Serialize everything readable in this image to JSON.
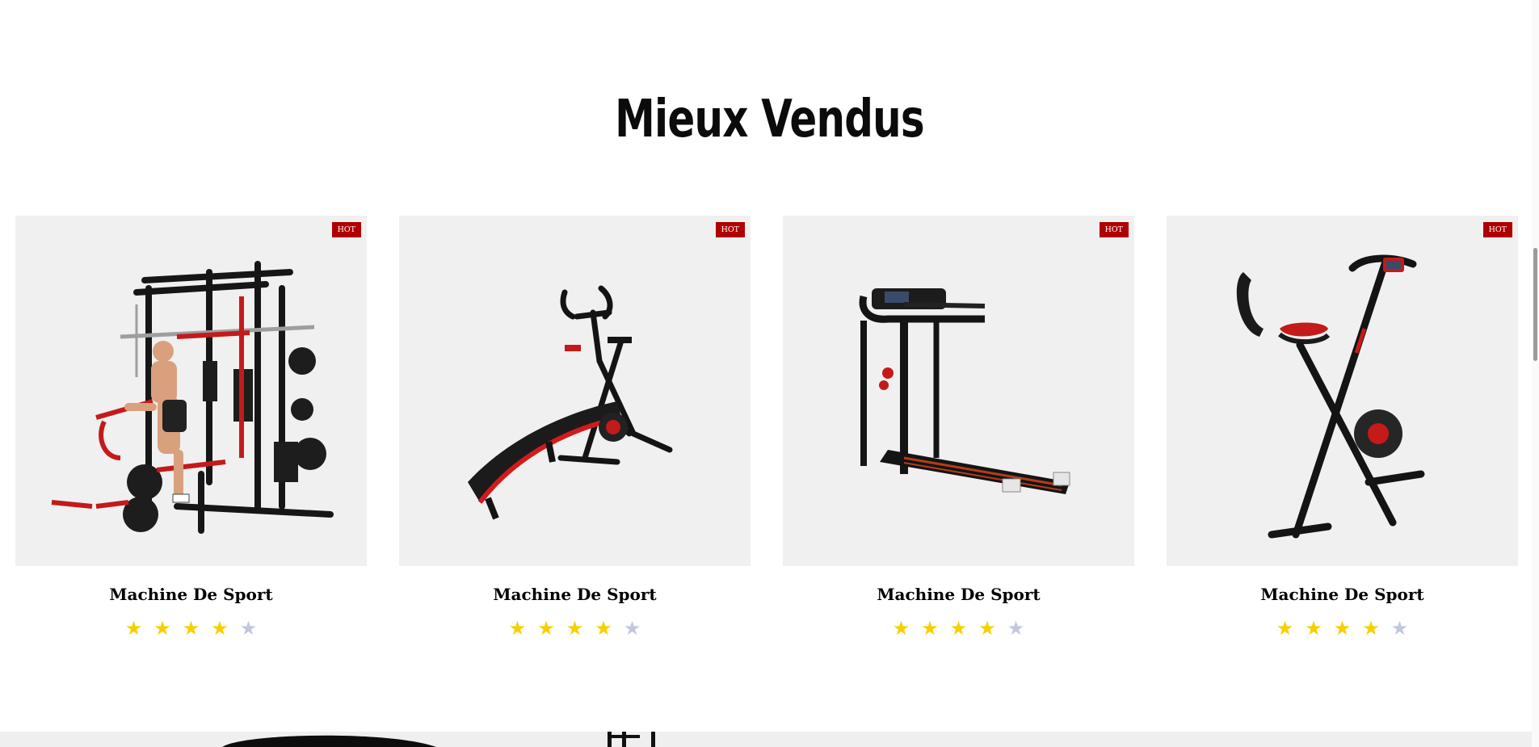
{
  "section": {
    "title": "Mieux Vendus"
  },
  "products": [
    {
      "name": "Machine De Sport",
      "badge": "HOT",
      "rating": 4,
      "rating_max": 5,
      "image": "home-gym-station-image"
    },
    {
      "name": "Machine De Sport",
      "badge": "HOT",
      "rating": 4,
      "rating_max": 5,
      "image": "sit-up-bench-exercise-bike-image"
    },
    {
      "name": "Machine De Sport",
      "badge": "HOT",
      "rating": 4,
      "rating_max": 5,
      "image": "treadmill-image"
    },
    {
      "name": "Machine De Sport",
      "badge": "HOT",
      "rating": 4,
      "rating_max": 5,
      "image": "folding-x-bike-image"
    }
  ],
  "colors": {
    "badge": "#b00000",
    "star_on": "#f7cf00",
    "star_off": "#c3c7dc",
    "card_bg": "#f0f0f0"
  }
}
